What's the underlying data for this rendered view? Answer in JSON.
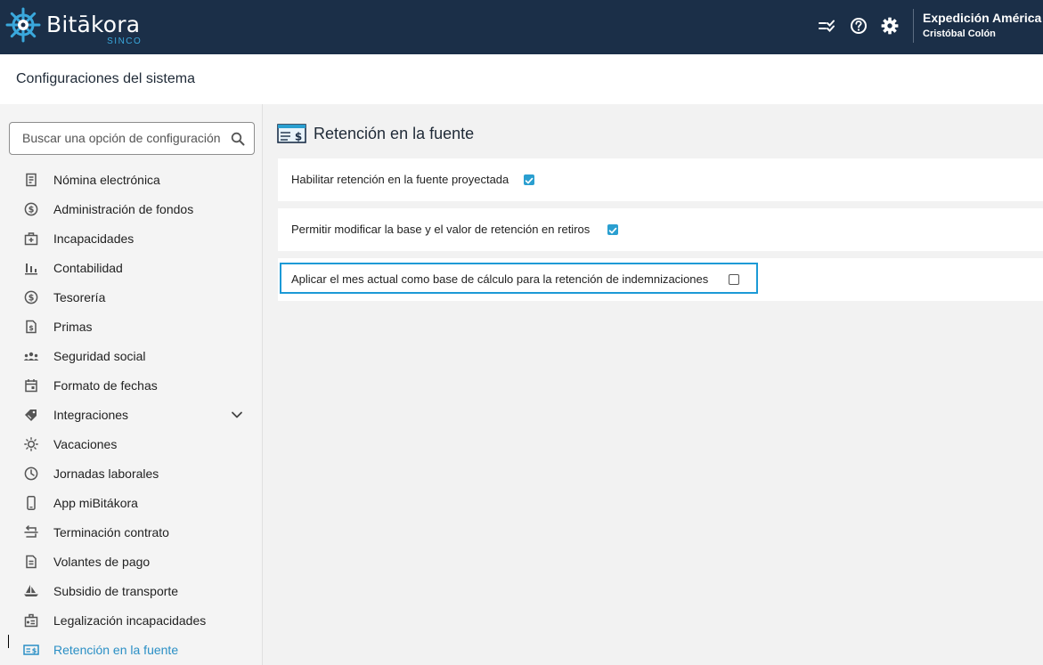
{
  "header": {
    "logo_name": "Bitākora",
    "logo_sub": "SINCO",
    "company": "Expedición América",
    "user": "Cristóbal Colón",
    "icons": [
      "checklist-icon",
      "help-icon",
      "settings-icon"
    ]
  },
  "titlebar": {
    "title": "Configuraciones del sistema"
  },
  "sidebar": {
    "search_placeholder": "Buscar una opción de configuración",
    "items": [
      {
        "label": "Nómina electrónica",
        "icon": "document-icon"
      },
      {
        "label": "Administración de fondos",
        "icon": "dollar-circle-icon"
      },
      {
        "label": "Incapacidades",
        "icon": "medical-briefcase-icon"
      },
      {
        "label": "Contabilidad",
        "icon": "bar-chart-icon"
      },
      {
        "label": "Tesorería",
        "icon": "dollar-circle-icon"
      },
      {
        "label": "Primas",
        "icon": "invoice-icon"
      },
      {
        "label": "Seguridad social",
        "icon": "group-icon"
      },
      {
        "label": "Formato de fechas",
        "icon": "calendar-icon"
      },
      {
        "label": "Integraciones",
        "icon": "tag-icon",
        "expandable": true
      },
      {
        "label": "Vacaciones",
        "icon": "sun-icon"
      },
      {
        "label": "Jornadas laborales",
        "icon": "clock-icon"
      },
      {
        "label": "App miBitákora",
        "icon": "phone-icon"
      },
      {
        "label": "Terminación contrato",
        "icon": "contract-end-icon"
      },
      {
        "label": "Volantes de pago",
        "icon": "payslip-icon"
      },
      {
        "label": "Subsidio de transporte",
        "icon": "boat-icon"
      },
      {
        "label": "Legalización incapacidades",
        "icon": "id-badge-icon"
      },
      {
        "label": "Retención en la fuente",
        "icon": "cheque-icon",
        "active": true
      }
    ]
  },
  "main": {
    "section_title": "Retención en la fuente",
    "options": [
      {
        "label": "Habilitar retención en la fuente proyectada",
        "checked": true
      },
      {
        "label": "Permitir modificar la base y el valor de retención en retiros",
        "checked": true
      },
      {
        "label": "Aplicar el mes actual como base de cálculo para la retención de indemnizaciones",
        "checked": false,
        "highlighted": true
      }
    ]
  },
  "colors": {
    "header_bg": "#1b2f48",
    "accent": "#2a9fd0",
    "highlight_border": "#1c9ad6",
    "active_text": "#2a8fc5"
  }
}
